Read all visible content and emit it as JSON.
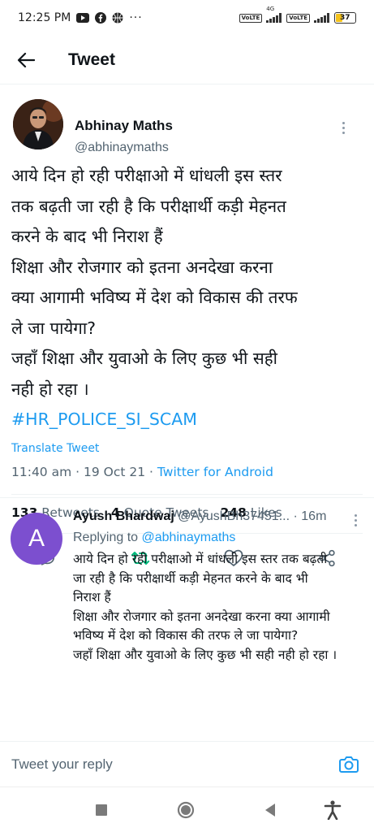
{
  "status_bar": {
    "time": "12:25 PM",
    "dots": "···",
    "lte1": "VoLTE",
    "net1": "4G",
    "lte2": "VoLTE",
    "battery": "37"
  },
  "header": {
    "title": "Tweet"
  },
  "tweet": {
    "author_name": "Abhinay Maths",
    "author_handle": "@abhinaymaths",
    "lines": [
      "आये दिन हो रही परीक्षाओ में धांधली इस स्तर",
      "तक बढ़ती जा रही है कि परीक्षार्थी कड़ी मेहनत",
      "करने के बाद भी निराश हैं",
      "शिक्षा और रोजगार को इतना अनदेखा करना",
      "क्या आगामी भविष्य में देश को विकास की तरफ",
      "ले जा पायेगा?",
      "जहाँ शिक्षा और युवाओ के लिए कुछ भी सही",
      "नही हो रहा ।"
    ],
    "hashtag": "#HR_POLICE_SI_SCAM",
    "translate": "Translate Tweet",
    "time": "11:40 am · 19 Oct 21 · ",
    "source": "Twitter for Android",
    "stats": {
      "retweets_count": "133",
      "retweets_label": "Retweets",
      "quotes_count": "4",
      "quotes_label": "Quote Tweets",
      "likes_count": "248",
      "likes_label": "Likes"
    },
    "icons": {
      "reply": "reply-icon",
      "retweet": "retweet-icon",
      "like": "heart-icon",
      "share": "share-icon",
      "retweet_color": "#00ba7c"
    }
  },
  "reply": {
    "avatar_letter": "A",
    "avatar_color": "#7c4fcf",
    "name": "Ayush Bhardwaj",
    "handle": "@AyushBh37451...",
    "time": " · 16m",
    "replying_prefix": "Replying to ",
    "replying_to": "@abhinaymaths",
    "lines": [
      "आये दिन हो रही परीक्षाओ में धांधली इस स्तर तक बढ़ती",
      "जा रही है कि परीक्षार्थी कड़ी मेहनत करने के बाद भी",
      "निराश हैं",
      "शिक्षा और रोजगार को इतना अनदेखा करना क्या आगामी",
      "भविष्य में देश को विकास की तरफ ले जा पायेगा?",
      "जहाँ शिक्षा और युवाओ के लिए कुछ भी सही नही हो रहा ।"
    ]
  },
  "compose": {
    "placeholder": "Tweet your reply"
  },
  "colors": {
    "accent": "#1d9bf0",
    "secondary_text": "#536471"
  }
}
